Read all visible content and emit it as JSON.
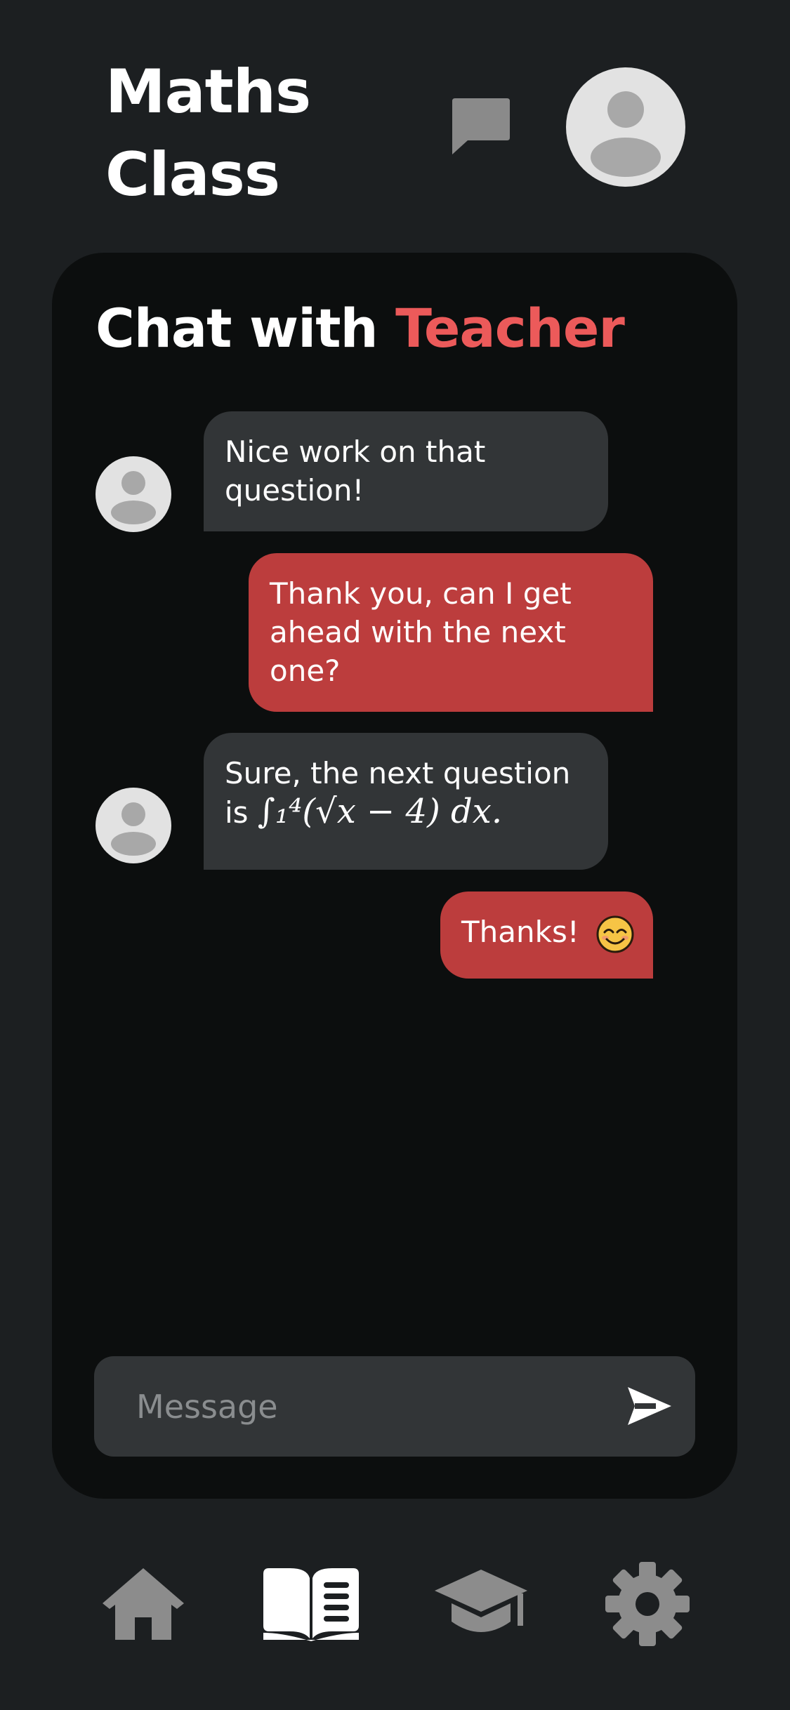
{
  "header": {
    "title": "Maths Class",
    "chat_icon": "chat-bubble-icon",
    "avatar_icon": "user-avatar-icon"
  },
  "chat": {
    "heading_prefix": "Chat with",
    "heading_accent": "Teacher",
    "messages": [
      {
        "from": "teacher",
        "text": "Nice work on that question!"
      },
      {
        "from": "student",
        "text": "Thank you, can I get ahead with the next one?"
      },
      {
        "from": "teacher",
        "text": "Sure, the next question is",
        "math": "∫₁⁴(√x − 4) dx."
      },
      {
        "from": "student",
        "text": "Thanks!",
        "emoji": "smiling-face-emoji"
      }
    ]
  },
  "composer": {
    "placeholder": "Message",
    "value": "",
    "send_icon": "send-icon"
  },
  "tabs": [
    {
      "name": "home",
      "icon": "home-icon",
      "active": false
    },
    {
      "name": "lessons",
      "icon": "book-icon",
      "active": true
    },
    {
      "name": "courses",
      "icon": "graduation-cap-icon",
      "active": false
    },
    {
      "name": "settings",
      "icon": "gear-icon",
      "active": false
    }
  ],
  "colors": {
    "background": "#1c1f21",
    "card": "#0c0e0e",
    "incoming_bubble": "#323537",
    "outgoing_bubble": "#bc3d3d",
    "accent": "#ec5a5a",
    "icon_inactive": "#8c8c8c",
    "icon_active": "#ffffff"
  }
}
